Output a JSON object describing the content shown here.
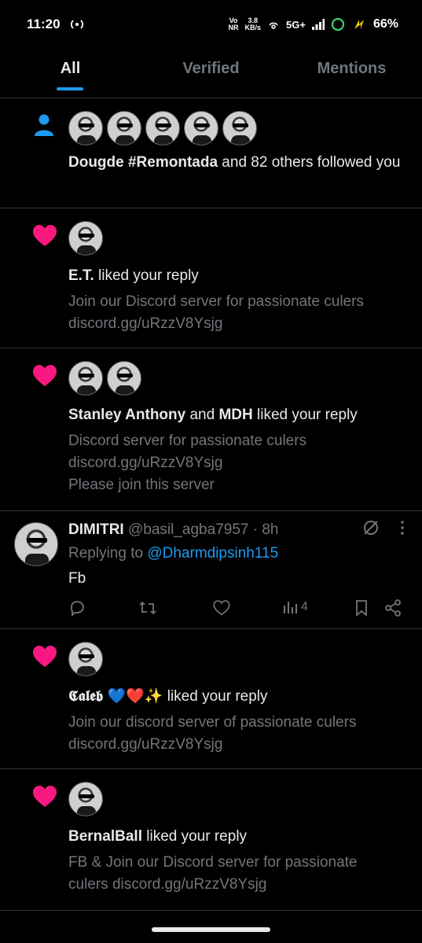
{
  "status": {
    "time": "11:20",
    "net_top": "Vo",
    "net_bottom": "NR",
    "speed_value": "3.8",
    "speed_unit": "KB/s",
    "network": "5G+",
    "battery": "66%"
  },
  "tabs": [
    {
      "label": "All"
    },
    {
      "label": "Verified"
    },
    {
      "label": "Mentions"
    }
  ],
  "notifications": [
    {
      "names": "Dougde #Remontada",
      "rest": " and 82 others followed you"
    },
    {
      "names": "E.T.",
      "rest": " liked your reply",
      "sub1": "Join our Discord server for passionate culers",
      "sub2": "discord.gg/uRzzV8Ysjg"
    },
    {
      "name_a": "Stanley Anthony",
      "and": " and ",
      "name_b": "MDH",
      "rest": " liked your reply",
      "sub1": "Discord server for passionate culers",
      "sub2": "discord.gg/uRzzV8Ysjg",
      "sub3": "Please join this server"
    },
    {
      "names": "𝕮𝖆𝖑𝖊𝖇 💙❤️✨",
      "rest": " liked your reply",
      "sub1": "Join our discord server of passionate culers",
      "sub2": "discord.gg/uRzzV8Ysjg"
    },
    {
      "names": "BernalBall",
      "rest": " liked your reply",
      "sub1": "FB & Join our Discord server for passionate",
      "sub2": "culers discord.gg/uRzzV8Ysjg"
    }
  ],
  "tweet": {
    "name": "DIMITRI",
    "handle": " @basil_agba7957 · 8h",
    "replying_prefix": "Replying to ",
    "replying_to": "@Dharmdipsinh115",
    "body": "Fb",
    "views": "4"
  },
  "colors": {
    "accent": "#1d9bf0",
    "like": "#f91880",
    "muted": "#71767b"
  }
}
